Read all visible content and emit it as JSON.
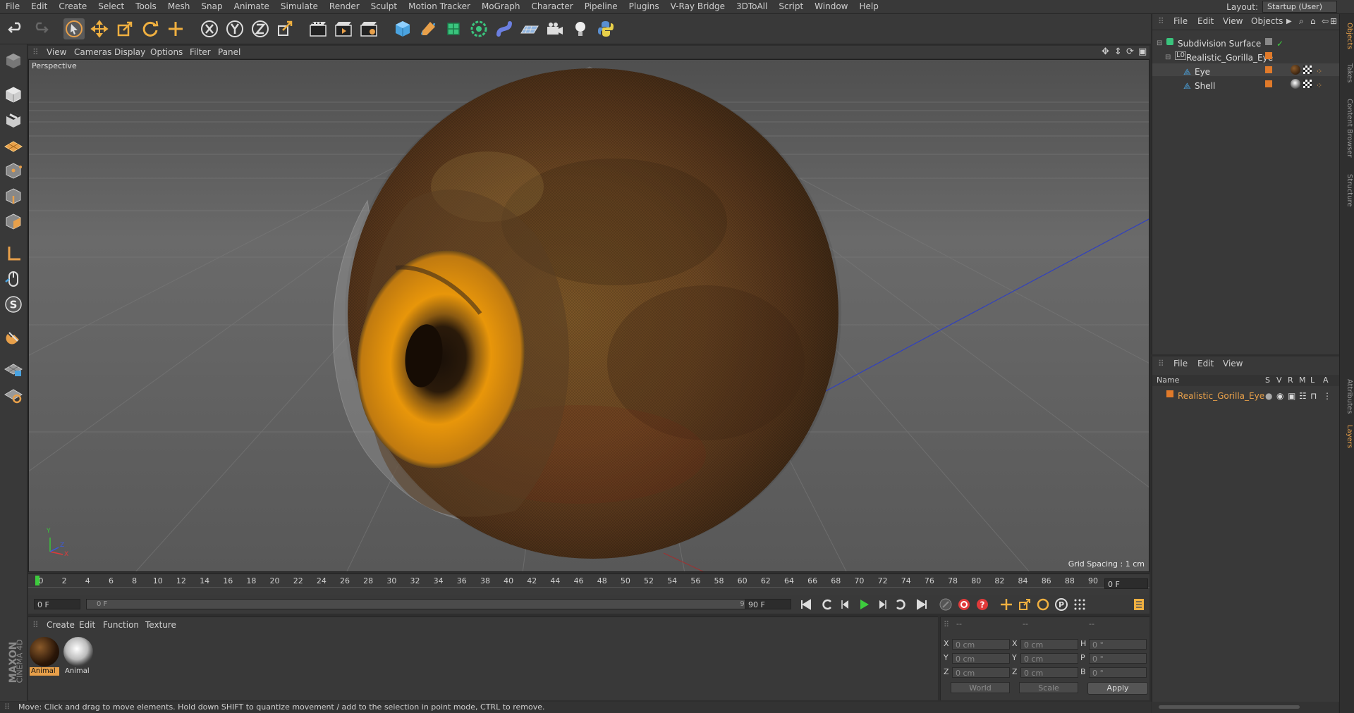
{
  "menubar": {
    "items": [
      "File",
      "Edit",
      "Create",
      "Select",
      "Tools",
      "Mesh",
      "Snap",
      "Animate",
      "Simulate",
      "Render",
      "Sculpt",
      "Motion Tracker",
      "MoGraph",
      "Character",
      "Pipeline",
      "Plugins",
      "V-Ray Bridge",
      "3DToAll",
      "Script",
      "Window",
      "Help"
    ],
    "layout_label": "Layout:",
    "layout_value": "Startup (User)"
  },
  "viewport": {
    "menu": [
      "View",
      "Cameras",
      "Display",
      "Options",
      "Filter",
      "Panel"
    ],
    "label": "Perspective",
    "grid_spacing": "Grid Spacing : 1 cm",
    "axis_y": "Y",
    "axis_x": "X",
    "axis_z": "Z"
  },
  "timeline": {
    "ticks": [
      "0",
      "2",
      "4",
      "6",
      "8",
      "10",
      "12",
      "14",
      "16",
      "18",
      "20",
      "22",
      "24",
      "26",
      "28",
      "30",
      "32",
      "34",
      "36",
      "38",
      "40",
      "42",
      "44",
      "46",
      "48",
      "50",
      "52",
      "54",
      "56",
      "58",
      "60",
      "62",
      "64",
      "66",
      "68",
      "70",
      "72",
      "74",
      "76",
      "78",
      "80",
      "82",
      "84",
      "86",
      "88",
      "90"
    ],
    "current_frame_right": "0 F",
    "start_field": "0 F",
    "range_start": "0 F",
    "range_end": "90 F",
    "end_field": "90 F"
  },
  "materials": {
    "menu": [
      "Create",
      "Edit",
      "Function",
      "Texture"
    ],
    "items": [
      {
        "label": "Animal"
      },
      {
        "label": "Animal"
      }
    ]
  },
  "coords": {
    "header_dashes": [
      "--",
      "--",
      "--"
    ],
    "rows": [
      {
        "l1": "X",
        "v1": "0 cm",
        "l2": "X",
        "v2": "0 cm",
        "l3": "H",
        "v3": "0 °"
      },
      {
        "l1": "Y",
        "v1": "0 cm",
        "l2": "Y",
        "v2": "0 cm",
        "l3": "P",
        "v3": "0 °"
      },
      {
        "l1": "Z",
        "v1": "0 cm",
        "l2": "Z",
        "v2": "0 cm",
        "l3": "B",
        "v3": "0 °"
      }
    ],
    "mode_world": "World",
    "mode_scale": "Scale",
    "apply": "Apply"
  },
  "status": "Move: Click and drag to move elements. Hold down SHIFT to quantize movement / add to the selection in point mode, CTRL to remove.",
  "object_manager": {
    "menu": [
      "File",
      "Edit",
      "View",
      "Objects"
    ],
    "objects": [
      {
        "name": "Subdivision Surface"
      },
      {
        "name": "Realistic_Gorilla_Eye"
      },
      {
        "name": "Eye"
      },
      {
        "name": "Shell"
      }
    ]
  },
  "layer_manager": {
    "menu": [
      "File",
      "Edit",
      "View"
    ],
    "columns": [
      "Name",
      "S",
      "V",
      "R",
      "M",
      "L",
      "A"
    ],
    "layers": [
      {
        "name": "Realistic_Gorilla_Eye"
      }
    ]
  },
  "side_tabs": [
    "Objects",
    "Takes",
    "Content Browser",
    "Structure",
    "Attributes",
    "Layers"
  ],
  "brand": {
    "line1": "MAXON",
    "line2": "CINEMA 4D"
  },
  "colors": {
    "accent_orange": "#e8a04a",
    "layer_color": "#e07a2a",
    "play_green": "#3dcc3d",
    "record_red": "#e03a3a"
  }
}
